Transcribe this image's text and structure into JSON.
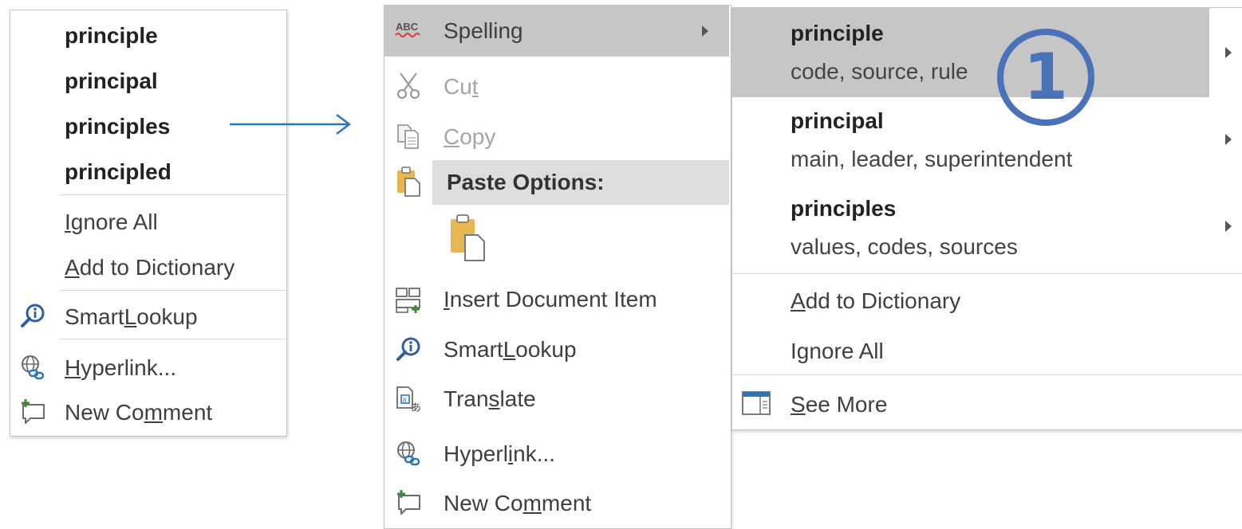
{
  "left_menu": {
    "suggestions": [
      "principle",
      "principal",
      "principles",
      "principled"
    ],
    "ignore_all": {
      "pre": "",
      "key": "I",
      "post": "gnore All"
    },
    "add_dictionary": {
      "pre": "",
      "key": "A",
      "post": "dd to Dictionary"
    },
    "smart_lookup": {
      "pre": "Smart ",
      "key": "L",
      "post": "ookup"
    },
    "hyperlink": {
      "pre": "",
      "key": "H",
      "post": "yperlink..."
    },
    "new_comment": {
      "pre": "New Co",
      "key": "m",
      "post": "ment"
    }
  },
  "main_menu": {
    "spelling_label": "Spelling",
    "spelling_icon_text": "ABC",
    "cut": {
      "pre": "Cu",
      "key": "t",
      "post": ""
    },
    "copy": {
      "pre": "",
      "key": "C",
      "post": "opy"
    },
    "paste_options_label": "Paste Options:",
    "insert_doc": {
      "pre": "",
      "key": "I",
      "post": "nsert Document Item"
    },
    "smart_lookup": {
      "pre": "Smart ",
      "key": "L",
      "post": "ookup"
    },
    "translate": {
      "pre": "Tran",
      "key": "s",
      "post": "late"
    },
    "hyperlink": {
      "pre": "Hyperl",
      "key": "i",
      "post": "nk..."
    },
    "new_comment": {
      "pre": "New Co",
      "key": "m",
      "post": "ment"
    }
  },
  "sub_menu": {
    "suggestions": [
      {
        "word": "principle",
        "synonyms": "code, source, rule"
      },
      {
        "word": "principal",
        "synonyms": "main, leader, superintendent"
      },
      {
        "word": "principles",
        "synonyms": "values, codes, sources"
      }
    ],
    "add_dictionary": {
      "pre": "",
      "key": "A",
      "post": "dd to Dictionary"
    },
    "ignore_all": {
      "pre": "I",
      "key": "g",
      "post": "nore All"
    },
    "see_more": {
      "pre": "",
      "key": "S",
      "post": "ee More"
    }
  },
  "callout_number": "1",
  "colors": {
    "accent_blue": "#2e75b6",
    "callout_blue": "#4a72b8",
    "highlight": "#c6c6c6",
    "paste_highlight": "#dddddd",
    "disabled_text": "#a6a6a6",
    "clipboard": "#e8b553"
  }
}
